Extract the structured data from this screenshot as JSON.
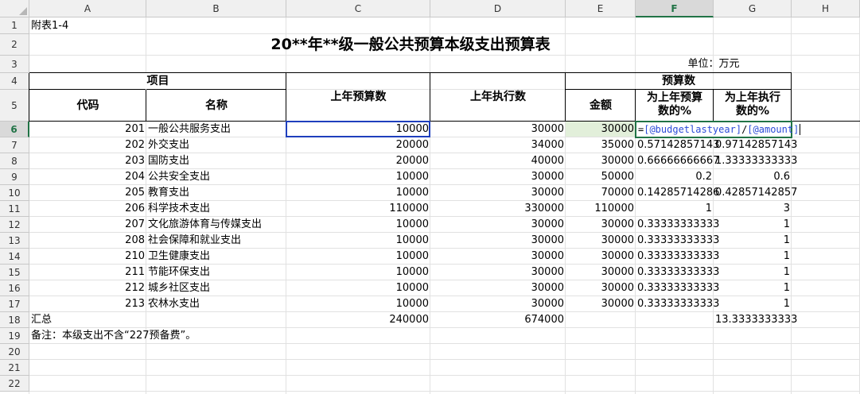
{
  "columns": [
    "A",
    "B",
    "C",
    "D",
    "E",
    "F",
    "G",
    "H"
  ],
  "rows": [
    "1",
    "2",
    "3",
    "4",
    "5",
    "6",
    "7",
    "8",
    "9",
    "10",
    "11",
    "12",
    "13",
    "14",
    "15",
    "16",
    "17",
    "18",
    "19",
    "20",
    "21",
    "22"
  ],
  "sheet": {
    "a1": "附表1-4",
    "title": "20**年**级一般公共预算本级支出预算表",
    "unit": "单位：万元",
    "headers": {
      "project": "项目",
      "code": "代码",
      "name": "名称",
      "last_budget": "上年预算数",
      "last_exec": "上年执行数",
      "budget": "预算数",
      "amount": "金额",
      "pct_budget_l1": "为上年预算",
      "pct_budget_l2": "数的%",
      "pct_exec_l1": "为上年执行",
      "pct_exec_l2": "数的%"
    },
    "data": [
      {
        "code": "201",
        "name": "一般公共服务支出",
        "last_budget": "10000",
        "last_exec": "30000",
        "amount": "30000",
        "pct_budget": "",
        "pct_exec": ""
      },
      {
        "code": "202",
        "name": "外交支出",
        "last_budget": "20000",
        "last_exec": "34000",
        "amount": "35000",
        "pct_budget": "0.57142857143",
        "pct_exec": "0.97142857143"
      },
      {
        "code": "203",
        "name": "国防支出",
        "last_budget": "20000",
        "last_exec": "40000",
        "amount": "30000",
        "pct_budget": "0.66666666667",
        "pct_exec": "1.33333333333"
      },
      {
        "code": "204",
        "name": "公共安全支出",
        "last_budget": "10000",
        "last_exec": "30000",
        "amount": "50000",
        "pct_budget": "0.2",
        "pct_exec": "0.6"
      },
      {
        "code": "205",
        "name": "教育支出",
        "last_budget": "10000",
        "last_exec": "30000",
        "amount": "70000",
        "pct_budget": "0.14285714286",
        "pct_exec": "0.42857142857"
      },
      {
        "code": "206",
        "name": "科学技术支出",
        "last_budget": "110000",
        "last_exec": "330000",
        "amount": "110000",
        "pct_budget": "1",
        "pct_exec": "3"
      },
      {
        "code": "207",
        "name": "文化旅游体育与传媒支出",
        "last_budget": "10000",
        "last_exec": "30000",
        "amount": "30000",
        "pct_budget": "0.33333333333",
        "pct_exec": "1"
      },
      {
        "code": "208",
        "name": "社会保障和就业支出",
        "last_budget": "10000",
        "last_exec": "30000",
        "amount": "30000",
        "pct_budget": "0.33333333333",
        "pct_exec": "1"
      },
      {
        "code": "210",
        "name": "卫生健康支出",
        "last_budget": "10000",
        "last_exec": "30000",
        "amount": "30000",
        "pct_budget": "0.33333333333",
        "pct_exec": "1"
      },
      {
        "code": "211",
        "name": "节能环保支出",
        "last_budget": "10000",
        "last_exec": "30000",
        "amount": "30000",
        "pct_budget": "0.33333333333",
        "pct_exec": "1"
      },
      {
        "code": "212",
        "name": "城乡社区支出",
        "last_budget": "10000",
        "last_exec": "30000",
        "amount": "30000",
        "pct_budget": "0.33333333333",
        "pct_exec": "1"
      },
      {
        "code": "213",
        "name": "农林水支出",
        "last_budget": "10000",
        "last_exec": "30000",
        "amount": "30000",
        "pct_budget": "0.33333333333",
        "pct_exec": "1"
      }
    ],
    "total": {
      "label": "汇总",
      "last_budget": "240000",
      "last_exec": "674000",
      "pct_exec": "13.3333333333"
    },
    "note": "备注：本级支出不含“227预备费”。",
    "editing_formula": {
      "eq": "=",
      "ref1": "[@budgetlastyear]",
      "op": "/",
      "ref2": "[@amount]"
    }
  },
  "colors": {
    "header_bg": "#f0f0f0",
    "active_header": "#217346",
    "selection": "#1f3fbd",
    "highlight_cell": "#e2efda"
  }
}
